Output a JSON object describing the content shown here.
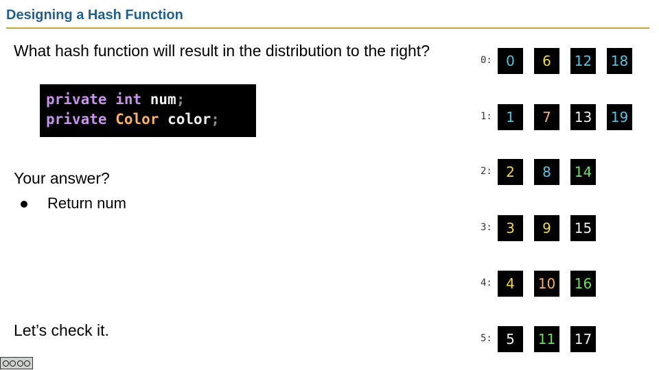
{
  "title": "Designing a Hash Function",
  "question": "What hash function will result in the distribution to the right?",
  "code": {
    "line1": {
      "keyword": "private",
      "type": "int",
      "name": "num",
      "semi": ";"
    },
    "line2": {
      "keyword": "private",
      "type": "Color",
      "name": "color",
      "semi": ";"
    }
  },
  "answer_label": "Your answer?",
  "answer_bullet": "Return num",
  "check": "Let’s check it.",
  "colors": {
    "title": "#1f5f8e",
    "rule": "#c9a227",
    "tile_bg": "#000000",
    "blue": "#55c6e8",
    "yellow": "#f3d94a",
    "orange": "#f6b26b",
    "green": "#6fe05f",
    "white": "#f0f0f0"
  },
  "buckets": [
    {
      "label": "0:",
      "items": [
        {
          "value": "0",
          "color": "#55c6e8"
        },
        {
          "value": "6",
          "color": "#f3d94a"
        },
        {
          "value": "12",
          "color": "#55c6e8"
        },
        {
          "value": "18",
          "color": "#55c6e8"
        }
      ]
    },
    {
      "label": "1:",
      "items": [
        {
          "value": "1",
          "color": "#55c6e8"
        },
        {
          "value": "7",
          "color": "#f6b26b"
        },
        {
          "value": "13",
          "color": "#f0f0f0"
        },
        {
          "value": "19",
          "color": "#55c6e8"
        }
      ]
    },
    {
      "label": "2:",
      "items": [
        {
          "value": "2",
          "color": "#f3d94a"
        },
        {
          "value": "8",
          "color": "#55c6e8"
        },
        {
          "value": "14",
          "color": "#6fe05f"
        }
      ]
    },
    {
      "label": "3:",
      "items": [
        {
          "value": "3",
          "color": "#f3d94a"
        },
        {
          "value": "9",
          "color": "#f3d94a"
        },
        {
          "value": "15",
          "color": "#f0f0f0"
        }
      ]
    },
    {
      "label": "4:",
      "items": [
        {
          "value": "4",
          "color": "#f3d94a"
        },
        {
          "value": "10",
          "color": "#f6b26b"
        },
        {
          "value": "16",
          "color": "#6fe05f"
        }
      ]
    },
    {
      "label": "5:",
      "items": [
        {
          "value": "5",
          "color": "#f0f0f0"
        },
        {
          "value": "11",
          "color": "#6fe05f"
        },
        {
          "value": "17",
          "color": "#f0f0f0"
        }
      ]
    }
  ],
  "license_icon": "creative-commons-badge"
}
